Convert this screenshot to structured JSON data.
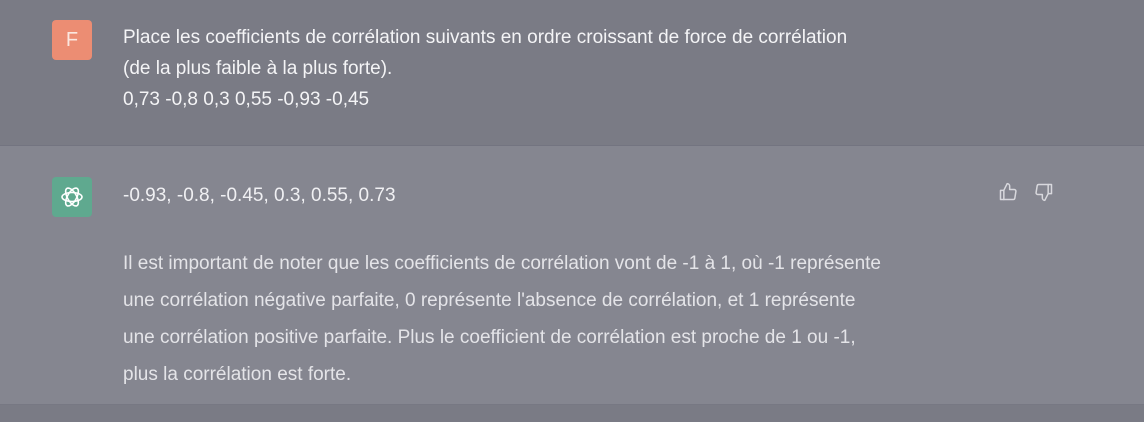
{
  "user_message": {
    "avatar_letter": "F",
    "lines": [
      "Place les coefficients de corrélation suivants en ordre croissant de force de corrélation",
      "(de la plus faible à la plus forte).",
      "0,73 -0,8 0,3 0,55 -0,93 -0,45"
    ]
  },
  "assistant_message": {
    "avatar_icon": "openai-logo-icon",
    "answer": "-0.93, -0.8, -0.45, 0.3, 0.55, 0.73",
    "explanation_lines": [
      "Il est important de noter que les coefficients de corrélation vont de -1 à 1, où -1 représente",
      "une corrélation négative parfaite, 0 représente l'absence de corrélation, et 1 représente",
      "une corrélation positive parfaite. Plus le coefficient de corrélation est proche de 1 ou -1,",
      "plus la corrélation est forte."
    ]
  },
  "feedback": {
    "thumbs_up_icon": "thumbs-up-icon",
    "thumbs_down_icon": "thumbs-down-icon"
  },
  "colors": {
    "user_avatar_bg": "#ec8d73",
    "assistant_avatar_bg": "#5fa98f",
    "user_row_bg": "#7a7b85",
    "assistant_row_bg": "#858690"
  }
}
